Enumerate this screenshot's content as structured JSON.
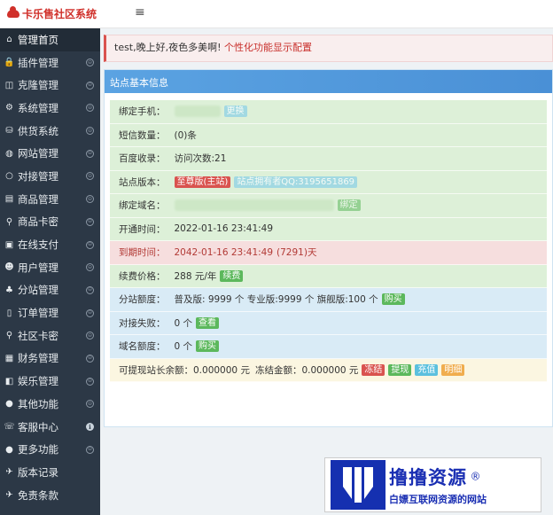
{
  "header": {
    "app_title": "卡乐售社区系统",
    "menu_toggle": "≡"
  },
  "sidebar": {
    "items": [
      {
        "label": "管理首页",
        "icon": "home-icon",
        "glyph": "⌂",
        "expand": ""
      },
      {
        "label": "插件管理",
        "icon": "lock-icon",
        "glyph": "🔒",
        "expand": "⊝"
      },
      {
        "label": "克隆管理",
        "icon": "clone-icon",
        "glyph": "◫",
        "expand": "⊝"
      },
      {
        "label": "系统管理",
        "icon": "gear-icon",
        "glyph": "⚙",
        "expand": "⊝"
      },
      {
        "label": "供货系统",
        "icon": "supply-icon",
        "glyph": "⛁",
        "expand": "⊝"
      },
      {
        "label": "网站管理",
        "icon": "globe-icon",
        "glyph": "◍",
        "expand": "⊝"
      },
      {
        "label": "对接管理",
        "icon": "link-icon",
        "glyph": "○",
        "expand": "⊝"
      },
      {
        "label": "商品管理",
        "icon": "product-icon",
        "glyph": "▤",
        "expand": "⊝"
      },
      {
        "label": "商品卡密",
        "icon": "card-key-icon",
        "glyph": "⚲",
        "expand": "⊝"
      },
      {
        "label": "在线支付",
        "icon": "payment-icon",
        "glyph": "▣",
        "expand": "⊝"
      },
      {
        "label": "用户管理",
        "icon": "user-icon",
        "glyph": "☻",
        "expand": "⊝"
      },
      {
        "label": "分站管理",
        "icon": "sitemap-icon",
        "glyph": "♣",
        "expand": "⊝"
      },
      {
        "label": "订单管理",
        "icon": "order-icon",
        "glyph": "▯",
        "expand": "⊝"
      },
      {
        "label": "社区卡密",
        "icon": "community-key-icon",
        "glyph": "⚲",
        "expand": "⊝"
      },
      {
        "label": "财务管理",
        "icon": "finance-icon",
        "glyph": "▦",
        "expand": "⊝"
      },
      {
        "label": "娱乐管理",
        "icon": "entertainment-icon",
        "glyph": "◧",
        "expand": "⊝"
      },
      {
        "label": "其他功能",
        "icon": "apple-icon",
        "glyph": "●",
        "expand": "⊝"
      },
      {
        "label": "客服中心",
        "icon": "support-icon",
        "glyph": "☏",
        "expand": "ℹ"
      },
      {
        "label": "更多功能",
        "icon": "apple-icon",
        "glyph": "●",
        "expand": "⊝"
      },
      {
        "label": "版本记录",
        "icon": "version-icon",
        "glyph": "✈",
        "expand": ""
      },
      {
        "label": "免责条款",
        "icon": "disclaimer-icon",
        "glyph": "✈",
        "expand": ""
      }
    ]
  },
  "greeting": {
    "text": "test,晚上好,夜色多美啊!",
    "link": "个性化功能显示配置"
  },
  "panel": {
    "title": "站点基本信息",
    "phone": {
      "label": "绑定手机：",
      "action": "更换"
    },
    "sms": {
      "label": "短信数量：",
      "value": "(0)条"
    },
    "baidu": {
      "label": "百度收录：",
      "value": "访问次数:21"
    },
    "version": {
      "label": "站点版本：",
      "badge": "至尊版(主站)",
      "note": "站点拥有者QQ:3195651869"
    },
    "domain": {
      "label": "绑定域名：",
      "action": "绑定"
    },
    "opened": {
      "label": "开通时间：",
      "value": "2022-01-16 23:41:49"
    },
    "expire": {
      "label": "到期时间：",
      "value": "2042-01-16 23:41:49",
      "days": "(7291)天"
    },
    "renew": {
      "label": "续费价格：",
      "value": "288 元/年",
      "action": "续费"
    },
    "quota": {
      "label": "分站额度：",
      "value": "普及版: 9999 个 专业版:9999 个 旗舰版:100 个",
      "action": "购买"
    },
    "dock_fail": {
      "label": "对接失败：",
      "value": "0 个",
      "action": "查看"
    },
    "domain_quota": {
      "label": "域名额度：",
      "value": "0 个",
      "action": "购买"
    },
    "balance": {
      "label": "可提现站长余额：",
      "value": "0.000000 元",
      "frozen_label": "冻结金额：",
      "frozen_value": "0.000000 元",
      "actions": [
        "冻结",
        "提现",
        "充值",
        "明细"
      ]
    }
  },
  "watermark": {
    "title": "撸撸资源",
    "registered": "®",
    "subtitle": "白嫖互联网资源的网站"
  },
  "colors": {
    "sidebar_bg": "#2c3846",
    "header_accent": "#d0302a",
    "panel_head": "#4a90d6",
    "green_row": "#ddf0d8",
    "red_row": "#f6dede",
    "blue_row": "#d9ebf6",
    "yellow_row": "#fbf6e1"
  }
}
